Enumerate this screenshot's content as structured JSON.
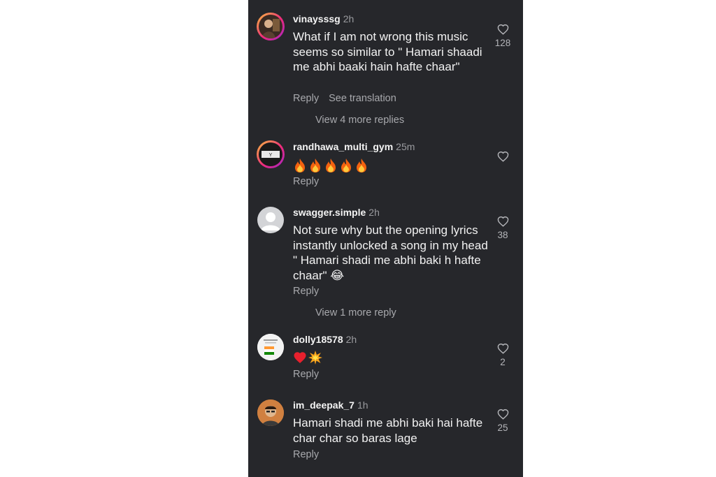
{
  "comments": [
    {
      "username": "vinaysssg",
      "time": "2h",
      "text": "What if I am not wrong this music seems so similar to \" Hamari shaadi me abhi baaki hain hafte chaar\"",
      "reply_label": "Reply",
      "translate_label": "See translation",
      "likes": "128",
      "more_replies": "View 4 more replies"
    },
    {
      "username": "randhawa_multi_gym",
      "time": "25m",
      "emojis": [
        "fire",
        "fire",
        "fire",
        "fire",
        "fire"
      ],
      "reply_label": "Reply"
    },
    {
      "username": "swagger.simple",
      "time": "2h",
      "text": "Not sure why but the opening lyrics instantly unlocked a song in my head \" Hamari shadi me abhi baki h hafte chaar\" 😂",
      "reply_label": "Reply",
      "likes": "38",
      "more_replies": "View 1 more reply"
    },
    {
      "username": "dolly18578",
      "time": "2h",
      "emojis": [
        "red-heart",
        "collision"
      ],
      "reply_label": "Reply",
      "likes": "2"
    },
    {
      "username": "im_deepak_7",
      "time": "1h",
      "text": "Hamari shadi me abhi baki hai hafte char char so baras lage",
      "reply_label": "Reply",
      "likes": "25"
    }
  ],
  "colors": {
    "background": "#26272b",
    "text": "#f2f2f2",
    "muted": "#a8a9ad"
  },
  "icons": {
    "like": "heart-outline-icon"
  }
}
